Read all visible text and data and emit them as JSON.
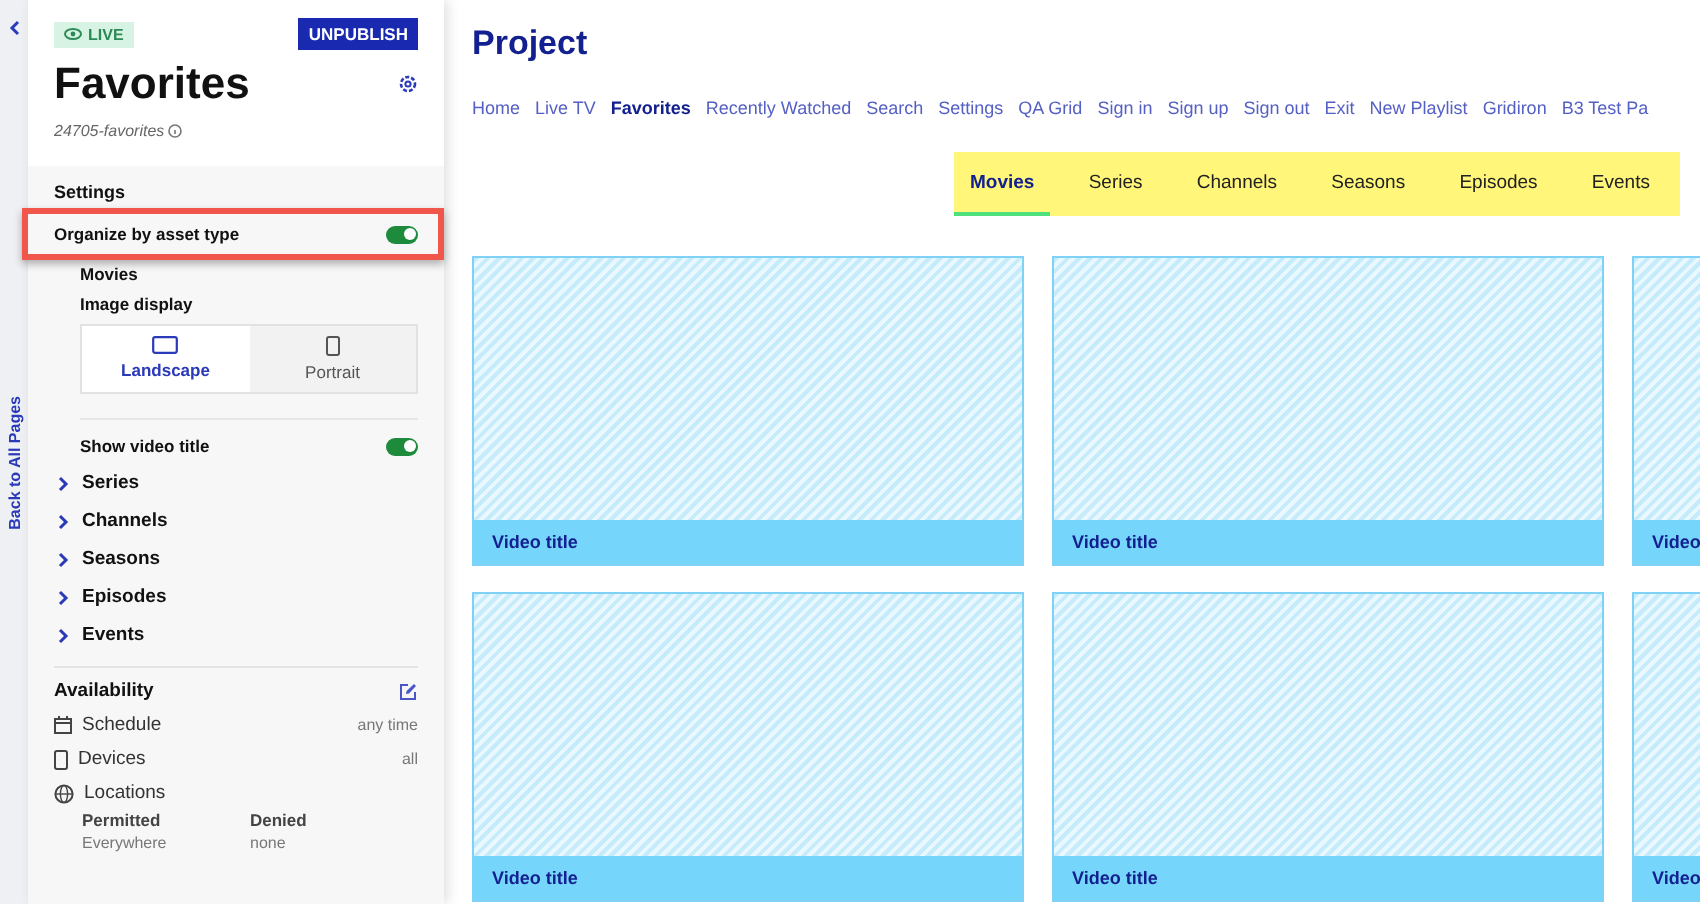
{
  "rail": {
    "back_label": "Back to All Pages"
  },
  "page": {
    "status": "LIVE",
    "publish_button": "UNPUBLISH",
    "title": "Favorites",
    "slug": "24705-favorites"
  },
  "settings": {
    "heading": "Settings",
    "organize": {
      "label": "Organize by asset type",
      "on": true
    },
    "movies": {
      "label": "Movies",
      "image_display": {
        "label": "Image display",
        "options": [
          {
            "label": "Landscape",
            "selected": true
          },
          {
            "label": "Portrait",
            "selected": false
          }
        ]
      },
      "show_title": {
        "label": "Show video title",
        "on": true
      }
    },
    "sections": [
      {
        "label": "Series",
        "expanded": false
      },
      {
        "label": "Channels",
        "expanded": false
      },
      {
        "label": "Seasons",
        "expanded": false
      },
      {
        "label": "Episodes",
        "expanded": false
      },
      {
        "label": "Events",
        "expanded": false
      }
    ]
  },
  "availability": {
    "heading": "Availability",
    "rows": [
      {
        "kind": "schedule",
        "label": "Schedule",
        "value": "any time"
      },
      {
        "kind": "devices",
        "label": "Devices",
        "value": "all"
      },
      {
        "kind": "locations",
        "label": "Locations"
      }
    ],
    "columns": [
      {
        "heading": "Permitted",
        "value": "Everywhere"
      },
      {
        "heading": "Denied",
        "value": "none"
      }
    ]
  },
  "main": {
    "title": "Project",
    "nav": [
      {
        "label": "Home",
        "selected": false
      },
      {
        "label": "Live TV",
        "selected": false
      },
      {
        "label": "Favorites",
        "selected": true
      },
      {
        "label": "Recently Watched",
        "selected": false
      },
      {
        "label": "Search",
        "selected": false
      },
      {
        "label": "Settings",
        "selected": false
      },
      {
        "label": "QA Grid",
        "selected": false
      },
      {
        "label": "Sign in",
        "selected": false
      },
      {
        "label": "Sign up",
        "selected": false
      },
      {
        "label": "Sign out",
        "selected": false
      },
      {
        "label": "Exit",
        "selected": false
      },
      {
        "label": "New Playlist",
        "selected": false
      },
      {
        "label": "Gridiron",
        "selected": false
      },
      {
        "label": "B3 Test Pa",
        "selected": false
      }
    ],
    "tabs": [
      {
        "label": "Movies",
        "selected": true
      },
      {
        "label": "Series",
        "selected": false
      },
      {
        "label": "Channels",
        "selected": false
      },
      {
        "label": "Seasons",
        "selected": false
      },
      {
        "label": "Episodes",
        "selected": false
      },
      {
        "label": "Events",
        "selected": false
      }
    ],
    "cards": [
      {
        "title": "Video title"
      },
      {
        "title": "Video title"
      },
      {
        "title": "Video"
      },
      {
        "title": "Video title"
      },
      {
        "title": "Video title"
      },
      {
        "title": "Video"
      }
    ]
  }
}
